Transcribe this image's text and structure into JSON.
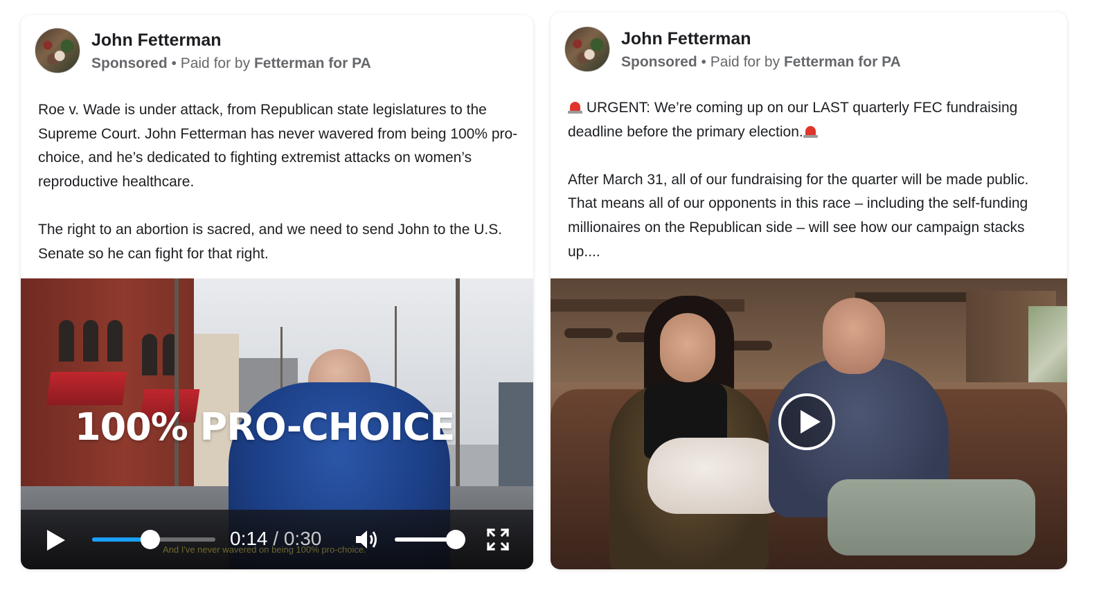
{
  "cards": [
    {
      "author": "John Fetterman",
      "sponsored_label": "Sponsored",
      "paid_for_prefix": " • Paid for by ",
      "paid_for_name": "Fetterman for PA",
      "paragraphs": [
        "Roe v. Wade is under attack, from Republican state legislatures to the Supreme Court. John Fetterman has never wavered from being 100% pro-choice, and he’s dedicated to fighting extremist attacks on women’s reproductive healthcare.",
        "The right to an abortion is sacred, and we need to send John to the U.S. Senate so he can fight for that right."
      ],
      "video": {
        "overlay_text": "100% PRO-CHOICE",
        "current_time": "0:14",
        "time_separator": " / ",
        "duration": "0:30",
        "progress": 0.47,
        "volume": 1.0,
        "caption": "And I've never wavered on being 100% pro-choice."
      }
    },
    {
      "author": "John Fetterman",
      "sponsored_label": "Sponsored",
      "paid_for_prefix": " • Paid for by ",
      "paid_for_name": "Fetterman for PA",
      "paragraph1": "URGENT: We’re coming up on our LAST quarterly FEC fundraising deadline before the primary election.",
      "paragraph2": "After March 31, all of our fundraising for the quarter will be made public. That means all of our opponents in this race – including the self-funding millionaires on the Republican side – will see how our campaign stacks up....",
      "icons": {
        "alarm": "police-light-icon"
      }
    }
  ],
  "colors": {
    "seek_fill": "#1aa0ff",
    "meta_text": "#65676b",
    "alarm_red": "#e0352b"
  }
}
